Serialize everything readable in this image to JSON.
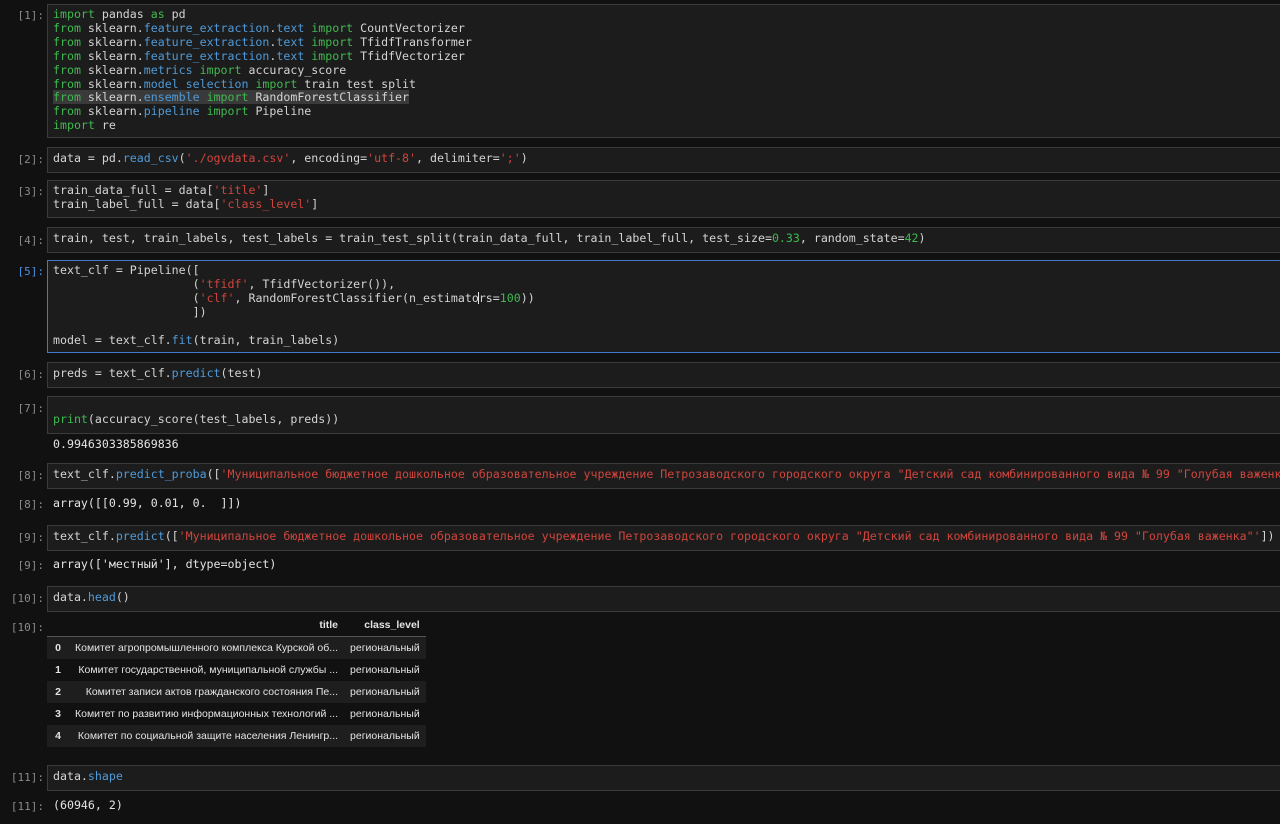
{
  "cells": [
    {
      "prompt": "[1]:",
      "lines": [
        "import pandas as pd",
        "from sklearn.feature_extraction.text import CountVectorizer",
        "from sklearn.feature_extraction.text import TfidfTransformer",
        "from sklearn.feature_extraction.text import TfidfVectorizer",
        "from sklearn.metrics import accuracy_score",
        "from sklearn.model_selection import train_test_split",
        "from sklearn.ensemble import RandomForestClassifier",
        "from sklearn.pipeline import Pipeline",
        "import re"
      ]
    },
    {
      "prompt": "[2]:",
      "code": "data = pd.read_csv('./ogvdata.csv', encoding='utf-8', delimiter=';')"
    },
    {
      "prompt": "[3]:",
      "lines": [
        "train_data_full = data['title']",
        "train_label_full = data['class_level']"
      ]
    },
    {
      "prompt": "[4]:",
      "code": "train, test, train_labels, test_labels = train_test_split(train_data_full, train_label_full, test_size=0.33, random_state=42)"
    },
    {
      "prompt": "[5]:",
      "lines": [
        "text_clf = Pipeline([",
        "                    ('tfidf', TfidfVectorizer()),",
        "                    ('clf', RandomForestClassifier(n_estimators=100))",
        "                    ])",
        "",
        "model = text_clf.fit(train, train_labels)"
      ]
    },
    {
      "prompt": "[6]:",
      "code": "preds = text_clf.predict(test)"
    },
    {
      "prompt": "[7]:",
      "code": "print(accuracy_score(test_labels, preds))",
      "output": "0.9946303385869836"
    },
    {
      "prompt": "[8]:",
      "code": "text_clf.predict_proba(['Муниципальное бюджетное дошкольное образовательное учреждение Петрозаводского городского округа \"Детский сад комбинированного вида № 99 \"Голубая важенка\"'])",
      "out_prompt": "[8]:",
      "output": "array([[0.99, 0.01, 0.  ]])"
    },
    {
      "prompt": "[9]:",
      "code": "text_clf.predict(['Муниципальное бюджетное дошкольное образовательное учреждение Петрозаводского городского округа \"Детский сад комбинированного вида № 99 \"Голубая важенка\"'])",
      "out_prompt": "[9]:",
      "output": "array(['местный'], dtype=object)"
    },
    {
      "prompt": "[10]:",
      "code": "data.head()",
      "out_prompt": "[10]:"
    },
    {
      "prompt": "[11]:",
      "code": "data.shape",
      "out_prompt": "[11]:",
      "output": "(60946, 2)"
    }
  ],
  "dataframe": {
    "columns": [
      "title",
      "class_level"
    ],
    "rows": [
      {
        "index": "0",
        "title": "Комитет агропромышленного комплекса Курской об...",
        "class_level": "региональный"
      },
      {
        "index": "1",
        "title": "Комитет государственной, муниципальной службы ...",
        "class_level": "региональный"
      },
      {
        "index": "2",
        "title": "Комитет записи актов гражданского состояния Пе...",
        "class_level": "региональный"
      },
      {
        "index": "3",
        "title": "Комитет по развитию информационных технологий ...",
        "class_level": "региональный"
      },
      {
        "index": "4",
        "title": "Комитет по социальной защите населения Ленингр...",
        "class_level": "региональный"
      }
    ]
  }
}
